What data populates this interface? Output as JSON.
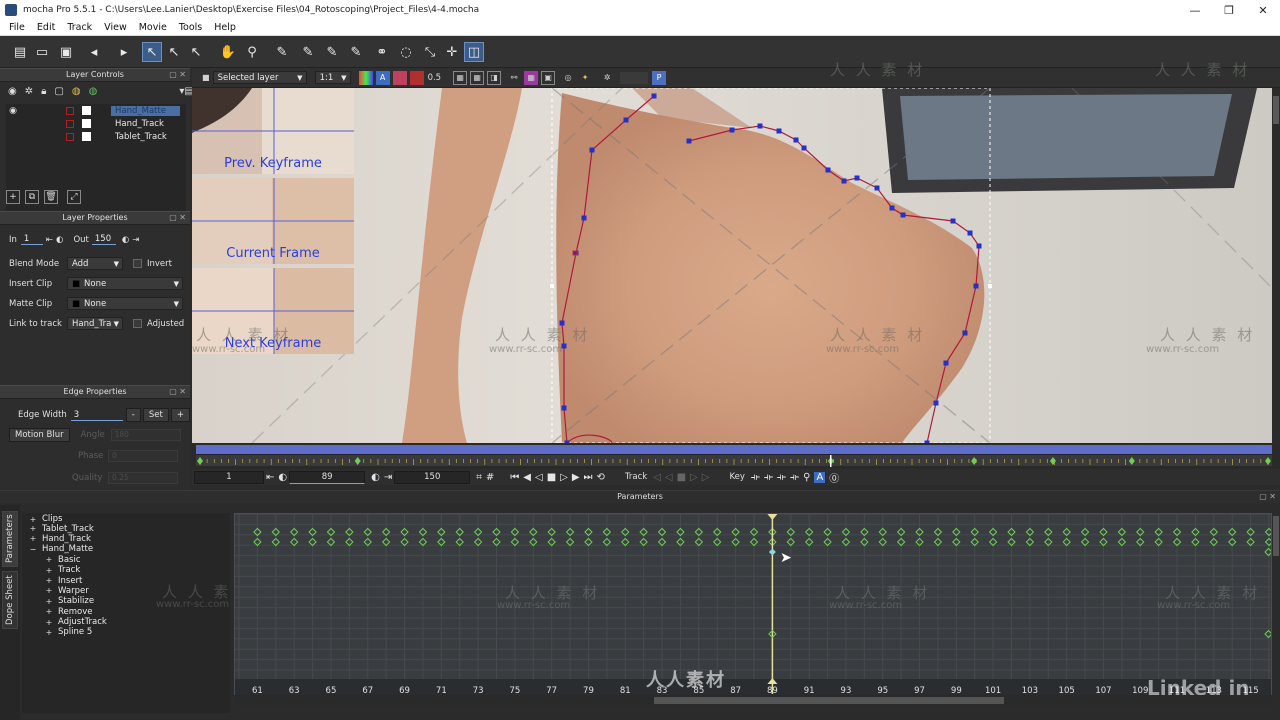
{
  "window": {
    "title": "mocha Pro 5.5.1 - C:\\Users\\Lee.Lanier\\Desktop\\Exercise Files\\04_Rotoscoping\\Project_Files\\4-4.mocha",
    "controls": [
      "—",
      "❐",
      "✕"
    ]
  },
  "menu": [
    "File",
    "Edit",
    "Track",
    "View",
    "Movie",
    "Tools",
    "Help"
  ],
  "layer_controls": {
    "title": "Layer Controls",
    "layers": [
      {
        "name": "Hand_Matte",
        "selected": true
      },
      {
        "name": "Hand_Track",
        "selected": false
      },
      {
        "name": "Tablet_Track",
        "selected": false
      }
    ]
  },
  "layer_properties": {
    "title": "Layer Properties",
    "in_label": "In",
    "in_value": "1",
    "out_label": "Out",
    "out_value": "150",
    "blend_mode_label": "Blend Mode",
    "blend_mode_value": "Add",
    "invert_label": "Invert",
    "insert_clip_label": "Insert Clip",
    "insert_clip_value": "None",
    "matte_clip_label": "Matte Clip",
    "matte_clip_value": "None",
    "link_label": "Link to track",
    "link_value": "Hand_Tra",
    "adjusted_label": "Adjusted"
  },
  "edge_properties": {
    "title": "Edge Properties",
    "edge_width_label": "Edge Width",
    "edge_width_value": "3",
    "set_label": "Set",
    "minus_label": "-",
    "plus_label": "+",
    "motion_blur_label": "Motion Blur",
    "angle_label": "Angle",
    "angle_value": "180",
    "phase_label": "Phase",
    "phase_value": "0",
    "quality_label": "Quality",
    "quality_value": "0.25"
  },
  "viewer_bar": {
    "layer_mode": "Selected layer",
    "zoom": "1:1",
    "opacity": "0.5",
    "proxy": "P"
  },
  "viewer": {
    "prev_keyframe": "Prev. Keyframe",
    "current_frame": "Current Frame",
    "next_keyframe": "Next Keyframe"
  },
  "transport": {
    "start": "1",
    "current": "89",
    "end": "150",
    "track_label": "Track",
    "key_label": "Key"
  },
  "parameters": {
    "title": "Parameters",
    "tabs": [
      "Parameters",
      "Dope Sheet"
    ],
    "tree": [
      {
        "label": "Clips",
        "sign": "+",
        "child": false
      },
      {
        "label": "Tablet_Track",
        "sign": "+",
        "child": false
      },
      {
        "label": "Hand_Track",
        "sign": "+",
        "child": false
      },
      {
        "label": "Hand_Matte",
        "sign": "−",
        "child": false
      },
      {
        "label": "Basic",
        "sign": "+",
        "child": true
      },
      {
        "label": "Track",
        "sign": "+",
        "child": true
      },
      {
        "label": "Insert",
        "sign": "+",
        "child": true
      },
      {
        "label": "Warper",
        "sign": "+",
        "child": true
      },
      {
        "label": "Stabilize",
        "sign": "+",
        "child": true
      },
      {
        "label": "Remove",
        "sign": "+",
        "child": true
      },
      {
        "label": "AdjustTrack",
        "sign": "+",
        "child": true
      },
      {
        "label": "Spline 5",
        "sign": "+",
        "child": true
      }
    ]
  },
  "dopesheet": {
    "frame_labels": [
      "61",
      "63",
      "65",
      "67",
      "69",
      "71",
      "73",
      "75",
      "77",
      "79",
      "81",
      "83",
      "85",
      "87",
      "89",
      "91",
      "93",
      "95",
      "97",
      "99",
      "101",
      "103",
      "105",
      "107",
      "109",
      "111",
      "113",
      "115"
    ],
    "current_frame": 89,
    "frame_start": 60,
    "frame_end": 116
  },
  "watermark": {
    "text": "人 人 素 材",
    "url": "www.rr-sc.com",
    "center": "人人素材",
    "linkedin": "Linked in"
  },
  "colors": {
    "spline": "#b01a3a",
    "point": "#2530c8",
    "keyframe": "#6ecf52",
    "timeline_range": "#5e6ec8",
    "selection": "#4a6fa5"
  }
}
